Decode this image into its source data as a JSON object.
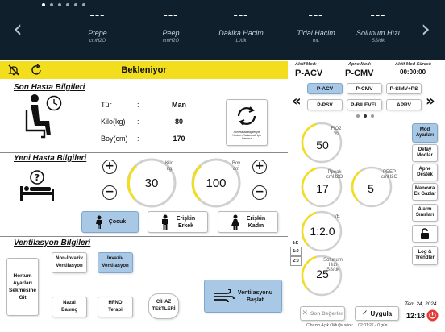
{
  "monitor": {
    "items": [
      {
        "value": "---",
        "label": "Ptepe",
        "unit": "cmH2O"
      },
      {
        "value": "---",
        "label": "Peep",
        "unit": "cmH2O"
      },
      {
        "value": "---",
        "label": "Dakika Hacim",
        "unit": "Lt/dk"
      },
      {
        "value": "---",
        "label": "Tidal Hacim",
        "unit": "mL"
      },
      {
        "value": "---",
        "label": "Solunum Hızı",
        "unit": "SS/dk"
      }
    ],
    "page_count": 6,
    "active_page": 0
  },
  "status": {
    "text": "Bekleniyor",
    "bar_color": "#f2de1c"
  },
  "last_patient": {
    "title": "Son Hasta Bilgileri",
    "type_label": "Tür",
    "type_value": "Man",
    "weight_label": "Kilo(kg)",
    "weight_value": "80",
    "height_label": "Boy(cm)",
    "height_value": "170",
    "colon": ":",
    "reset_caption": "Son Hasta Bilgileriyle Yeniden Kullanmak için Basınız"
  },
  "new_patient": {
    "title": "Yeni Hasta Bilgileri",
    "weight": {
      "value": "30",
      "label": "Kilo",
      "unit": "kg"
    },
    "height": {
      "value": "100",
      "label": "Boy",
      "unit": "cm"
    },
    "plus": "+",
    "minus": "−",
    "buttons": [
      {
        "label": "Çocuk",
        "selected": true
      },
      {
        "label": "Erişkin Erkek",
        "line1": "Erişkin",
        "line2": "Erkek",
        "selected": false
      },
      {
        "label": "Erişkin Kadın",
        "line1": "Erişkin",
        "line2": "Kadın",
        "selected": false
      }
    ]
  },
  "ventilation": {
    "title": "Ventilasyon Bilgileri",
    "hose": {
      "line1": "Hortum",
      "line2": "Ayarları",
      "line3": "Sekmesine",
      "line4": "Git"
    },
    "noninvasive": {
      "line1": "Non-İnvaziv",
      "line2": "Ventilasyon"
    },
    "invasive": {
      "line1": "İnvaziv",
      "line2": "Ventilasyon"
    },
    "nasal": {
      "line1": "Nazal",
      "line2": "Basınç"
    },
    "hfno": {
      "line1": "HFNO",
      "line2": "Terapi"
    },
    "device_test": {
      "line1": "CİHAZ",
      "line2": "TESTLERİ"
    },
    "start": {
      "line1": "Ventilasyonu",
      "line2": "Başlat"
    }
  },
  "modes": {
    "active_head": "Aktif Mod:",
    "active": "P-ACV",
    "apnea_head": "Apne Mod:",
    "apnea": "P-CMV",
    "duration_head": "Aktif Mod Süresi:",
    "duration": "00:00:00",
    "list": [
      {
        "label": "P-ACV",
        "selected": true
      },
      {
        "label": "P-CMV",
        "selected": false
      },
      {
        "label": "P-SIMV+PS",
        "selected": false
      },
      {
        "label": "P-PSV",
        "selected": false
      },
      {
        "label": "P-BILEVEL",
        "selected": false
      },
      {
        "label": "APRV",
        "selected": false
      }
    ],
    "prev": "«",
    "next": "»",
    "page_count": 3,
    "active_page": 1
  },
  "params": {
    "fio2": {
      "value": "50",
      "label": "FiO2",
      "unit": "%"
    },
    "ppeak": {
      "value": "17",
      "label": "Ppeak",
      "unit": "cmH2O"
    },
    "peep": {
      "value": "5",
      "label": "PEEP",
      "unit": "cmH2O"
    },
    "ie": {
      "value": "1:2.0",
      "label": "I/E"
    },
    "rr": {
      "value": "25",
      "label": "Solunum Hızı",
      "unit": "SS/dk"
    },
    "ie_small": [
      "I:E",
      "1:0",
      "2:0"
    ]
  },
  "side_menu": [
    {
      "line1": "Mod",
      "line2": "Ayarları",
      "selected": true
    },
    {
      "line1": "Detay",
      "line2": "Modlar",
      "selected": false
    },
    {
      "line1": "Apne",
      "line2": "Destek",
      "selected": false
    },
    {
      "line1": "Manevra",
      "line2": "Ek Gazlar",
      "selected": false
    },
    {
      "line1": "Alarm",
      "line2": "Sınırları",
      "selected": false
    },
    {
      "line1": "",
      "line2": "",
      "selected": false
    },
    {
      "line1": "Log &",
      "line2": "Trendler",
      "selected": false
    }
  ],
  "footer": {
    "prev_values": "Son Değerler",
    "apply": "Uygula",
    "open_since_label": "Cihazın Açık Olduğu süre:",
    "open_since_value": "02:01:26 - 0 gün",
    "date": "Tem 24, 2024",
    "time": "12:18"
  },
  "colors": {
    "accent": "#a8c8e6",
    "topbar": "#0f1f2c",
    "status": "#f2de1c",
    "power": "#e53935",
    "dial_yellow": "#f2de1c"
  }
}
